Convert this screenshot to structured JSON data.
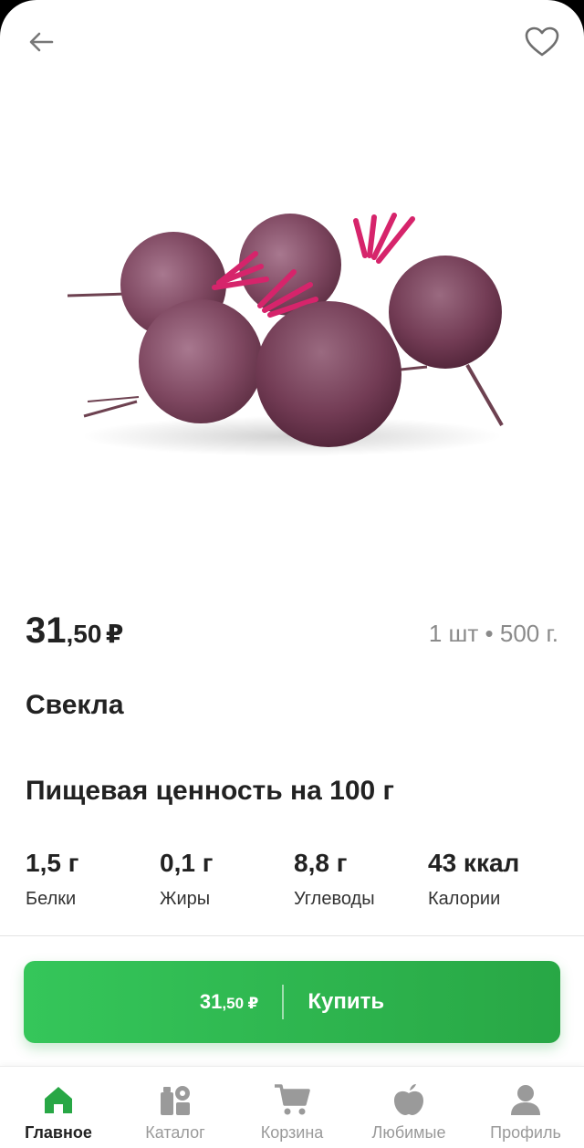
{
  "product": {
    "price_int": "31",
    "price_frac": ",50",
    "currency": "₽",
    "unit": "1 шт • 500 г.",
    "name": "Свекла"
  },
  "nutrition": {
    "title": "Пищевая ценность на 100 г",
    "items": [
      {
        "value": "1,5 г",
        "label": "Белки"
      },
      {
        "value": "0,1 г",
        "label": "Жиры"
      },
      {
        "value": "8,8 г",
        "label": "Углеводы"
      },
      {
        "value": "43 ккал",
        "label": "Калории"
      }
    ]
  },
  "buy_button": {
    "price_int": "31",
    "price_frac": ",50",
    "currency": "₽",
    "label": "Купить"
  },
  "nav": {
    "items": [
      {
        "label": "Главное",
        "icon": "home-icon",
        "active": true
      },
      {
        "label": "Каталог",
        "icon": "catalog-icon",
        "active": false
      },
      {
        "label": "Корзина",
        "icon": "cart-icon",
        "active": false
      },
      {
        "label": "Любимые",
        "icon": "favorites-icon",
        "active": false
      },
      {
        "label": "Профиль",
        "icon": "profile-icon",
        "active": false
      }
    ]
  },
  "colors": {
    "accent": "#28a745",
    "accent_light": "#35c65a",
    "nav_inactive": "#9a9a9a",
    "text_dark": "#222222"
  }
}
